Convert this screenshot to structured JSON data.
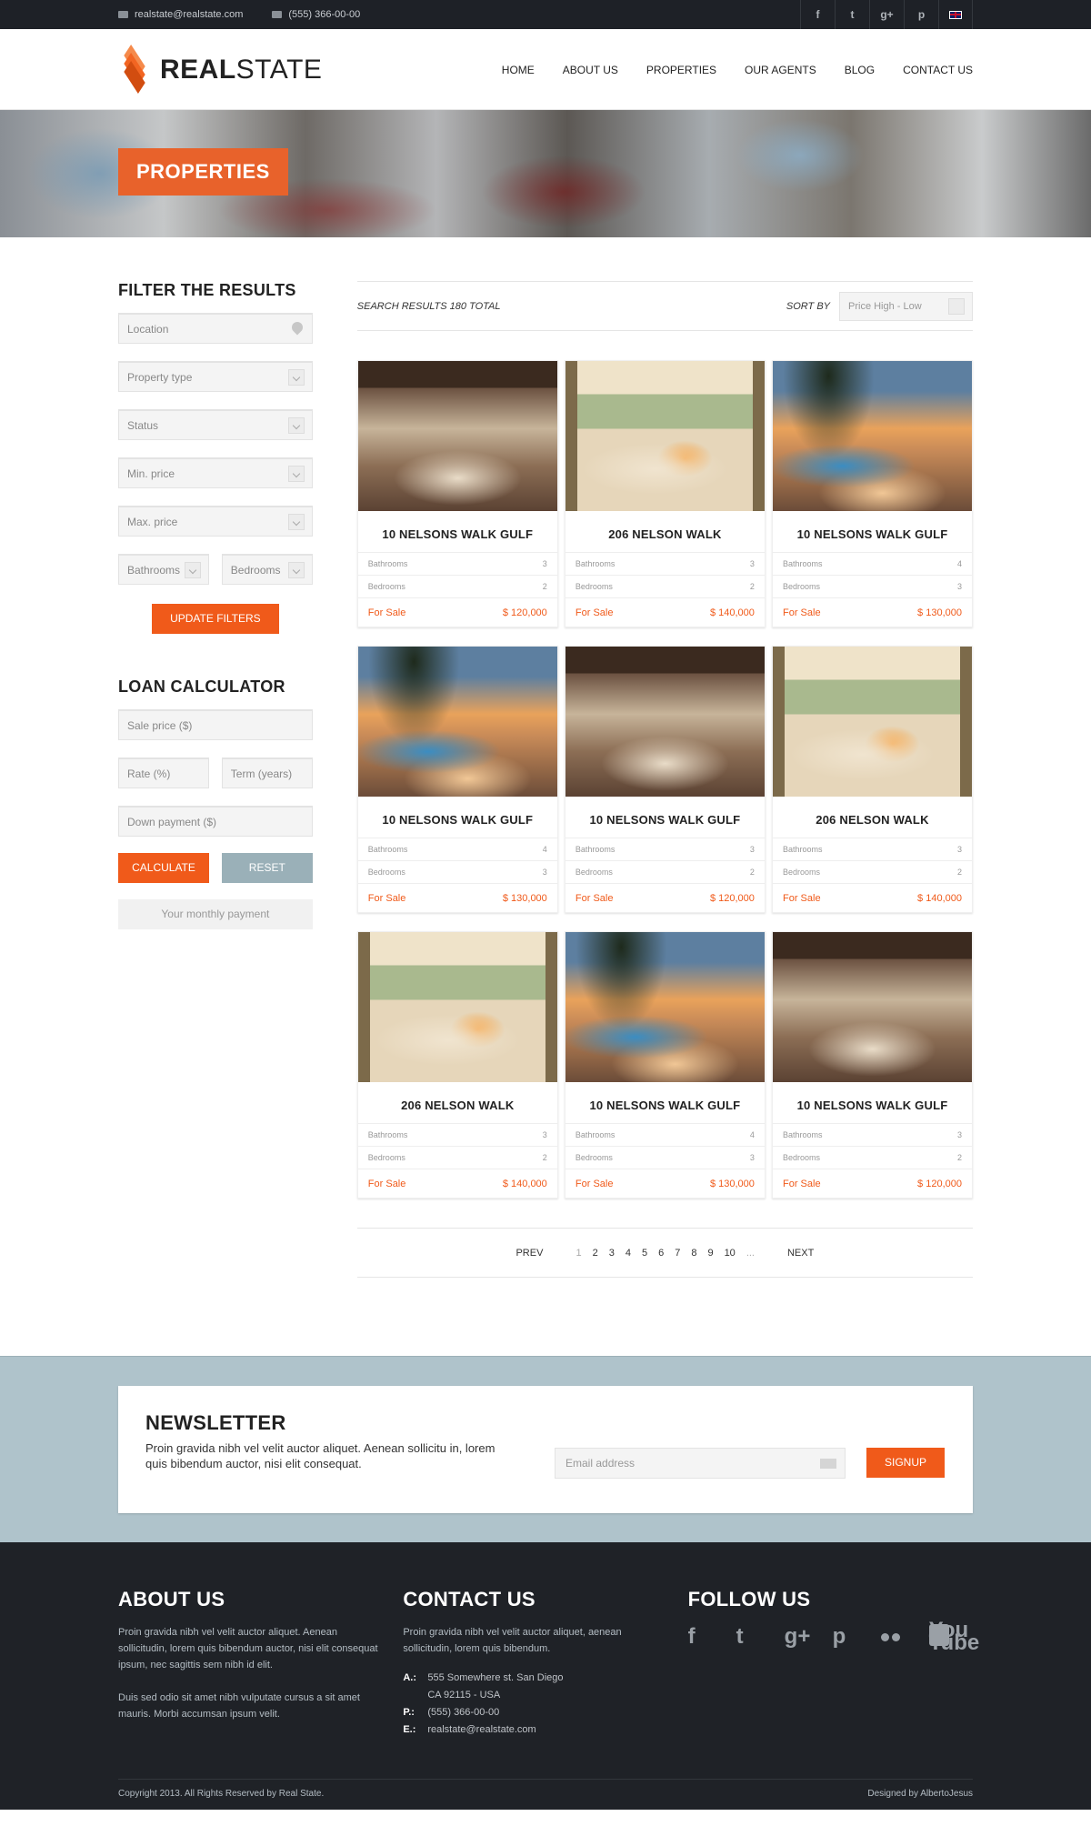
{
  "topbar": {
    "email": "realstate@realstate.com",
    "phone": "(555) 366-00-00",
    "social": [
      "f",
      "t",
      "g+",
      "p"
    ]
  },
  "header": {
    "logo_bold": "REAL",
    "logo_light": "STATE",
    "nav": [
      "HOME",
      "ABOUT US",
      "PROPERTIES",
      "OUR AGENTS",
      "BLOG",
      "CONTACT US"
    ]
  },
  "banner": {
    "title": "PROPERTIES"
  },
  "filter": {
    "heading": "FILTER THE RESULTS",
    "location": "Location",
    "property_type": "Property type",
    "status": "Status",
    "min_price": "Min. price",
    "max_price": "Max. price",
    "bathrooms": "Bathrooms",
    "bedrooms": "Bedrooms",
    "update": "UPDATE FILTERS"
  },
  "loan": {
    "heading": "LOAN CALCULATOR",
    "sale_price": "Sale price ($)",
    "rate": "Rate (%)",
    "term": "Term (years)",
    "down_payment": "Down payment ($)",
    "calculate": "CALCULATE",
    "reset": "RESET",
    "monthly": "Your monthly payment"
  },
  "results": {
    "summary": "SEARCH RESULTS 180 TOTAL",
    "sort_label": "SORT BY",
    "sort_value": "Price High - Low"
  },
  "listing_labels": {
    "bathrooms": "Bathrooms",
    "bedrooms": "Bedrooms",
    "status": "For Sale"
  },
  "listings": [
    {
      "title": "10 NELSONS WALK GULF",
      "baths": "3",
      "beds": "2",
      "price": "$ 120,000",
      "img": "room"
    },
    {
      "title": "206 NELSON WALK",
      "baths": "3",
      "beds": "2",
      "price": "$ 140,000",
      "img": "light"
    },
    {
      "title": "10 NELSONS WALK GULF",
      "baths": "4",
      "beds": "3",
      "price": "$ 130,000",
      "img": "pool"
    },
    {
      "title": "10 NELSONS WALK GULF",
      "baths": "4",
      "beds": "3",
      "price": "$ 130,000",
      "img": "pool"
    },
    {
      "title": "10 NELSONS WALK GULF",
      "baths": "3",
      "beds": "2",
      "price": "$ 120,000",
      "img": "room"
    },
    {
      "title": "206 NELSON WALK",
      "baths": "3",
      "beds": "2",
      "price": "$ 140,000",
      "img": "light"
    },
    {
      "title": "206 NELSON WALK",
      "baths": "3",
      "beds": "2",
      "price": "$ 140,000",
      "img": "light"
    },
    {
      "title": "10 NELSONS WALK GULF",
      "baths": "4",
      "beds": "3",
      "price": "$ 130,000",
      "img": "pool"
    },
    {
      "title": "10 NELSONS WALK GULF",
      "baths": "3",
      "beds": "2",
      "price": "$ 120,000",
      "img": "room"
    }
  ],
  "pagination": {
    "prev": "PREV",
    "pages": [
      "1",
      "2",
      "3",
      "4",
      "5",
      "6",
      "7",
      "8",
      "9",
      "10"
    ],
    "current": "1",
    "ellipsis": "...",
    "next": "NEXT"
  },
  "newsletter": {
    "heading": "NEWSLETTER",
    "text": "Proin gravida nibh vel velit auctor aliquet. Aenean sollicitu in, lorem quis bibendum auctor, nisi elit consequat.",
    "email_placeholder": "Email address",
    "signup": "SIGNUP"
  },
  "footer": {
    "about": {
      "heading": "ABOUT US",
      "p1": "Proin gravida nibh vel velit auctor aliquet. Aenean sollicitudin, lorem quis bibendum auctor, nisi elit consequat ipsum, nec sagittis sem nibh id elit.",
      "p2": "Duis sed odio sit amet nibh vulputate cursus a sit amet mauris. Morbi accumsan ipsum velit."
    },
    "contact": {
      "heading": "CONTACT US",
      "text": "Proin gravida nibh vel velit auctor aliquet, aenean sollicitudin, lorem quis bibendum.",
      "address_label": "A.:",
      "address_line1": "555 Somewhere st. San Diego",
      "address_line2": "CA 92115 - USA",
      "phone_label": "P.:",
      "phone": "(555) 366-00-00",
      "email_label": "E.:",
      "email": "realstate@realstate.com"
    },
    "follow": {
      "heading": "FOLLOW US",
      "icons": [
        "f",
        "t",
        "g+",
        "p"
      ],
      "youtube_line1": "You",
      "youtube_line2": "Tube"
    },
    "copyright": "Copyright 2013. All Rights Reserved by Real State.",
    "credit": "Designed by AlbertoJesus"
  },
  "colors": {
    "accent": "#f05a1a",
    "dark": "#1e2127",
    "newsletter_bg": "#afc3cb",
    "reset": "#9ab0b8"
  }
}
